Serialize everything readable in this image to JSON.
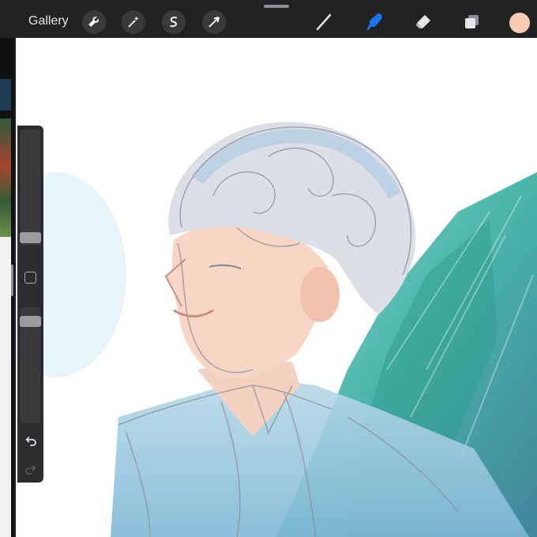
{
  "topbar": {
    "gallery_label": "Gallery",
    "tools": [
      {
        "icon": "wrench-icon",
        "active": false
      },
      {
        "icon": "magic-wand-icon",
        "active": false
      },
      {
        "icon": "selection-icon",
        "active": false
      },
      {
        "icon": "transform-arrow-icon",
        "active": false
      },
      {
        "icon": "brush-icon",
        "active": false
      },
      {
        "icon": "smudge-icon",
        "active": true
      },
      {
        "icon": "eraser-icon",
        "active": false
      },
      {
        "icon": "layers-icon",
        "active": false
      }
    ],
    "current_color": "#f7cbb6",
    "active_color": "#1a73f0"
  },
  "sidebar": {
    "brush_size_level": 0.93,
    "opacity_level": 0.09,
    "modify_icon": "square-icon",
    "undo_icon": "undo-icon",
    "redo_icon": "redo-icon"
  }
}
